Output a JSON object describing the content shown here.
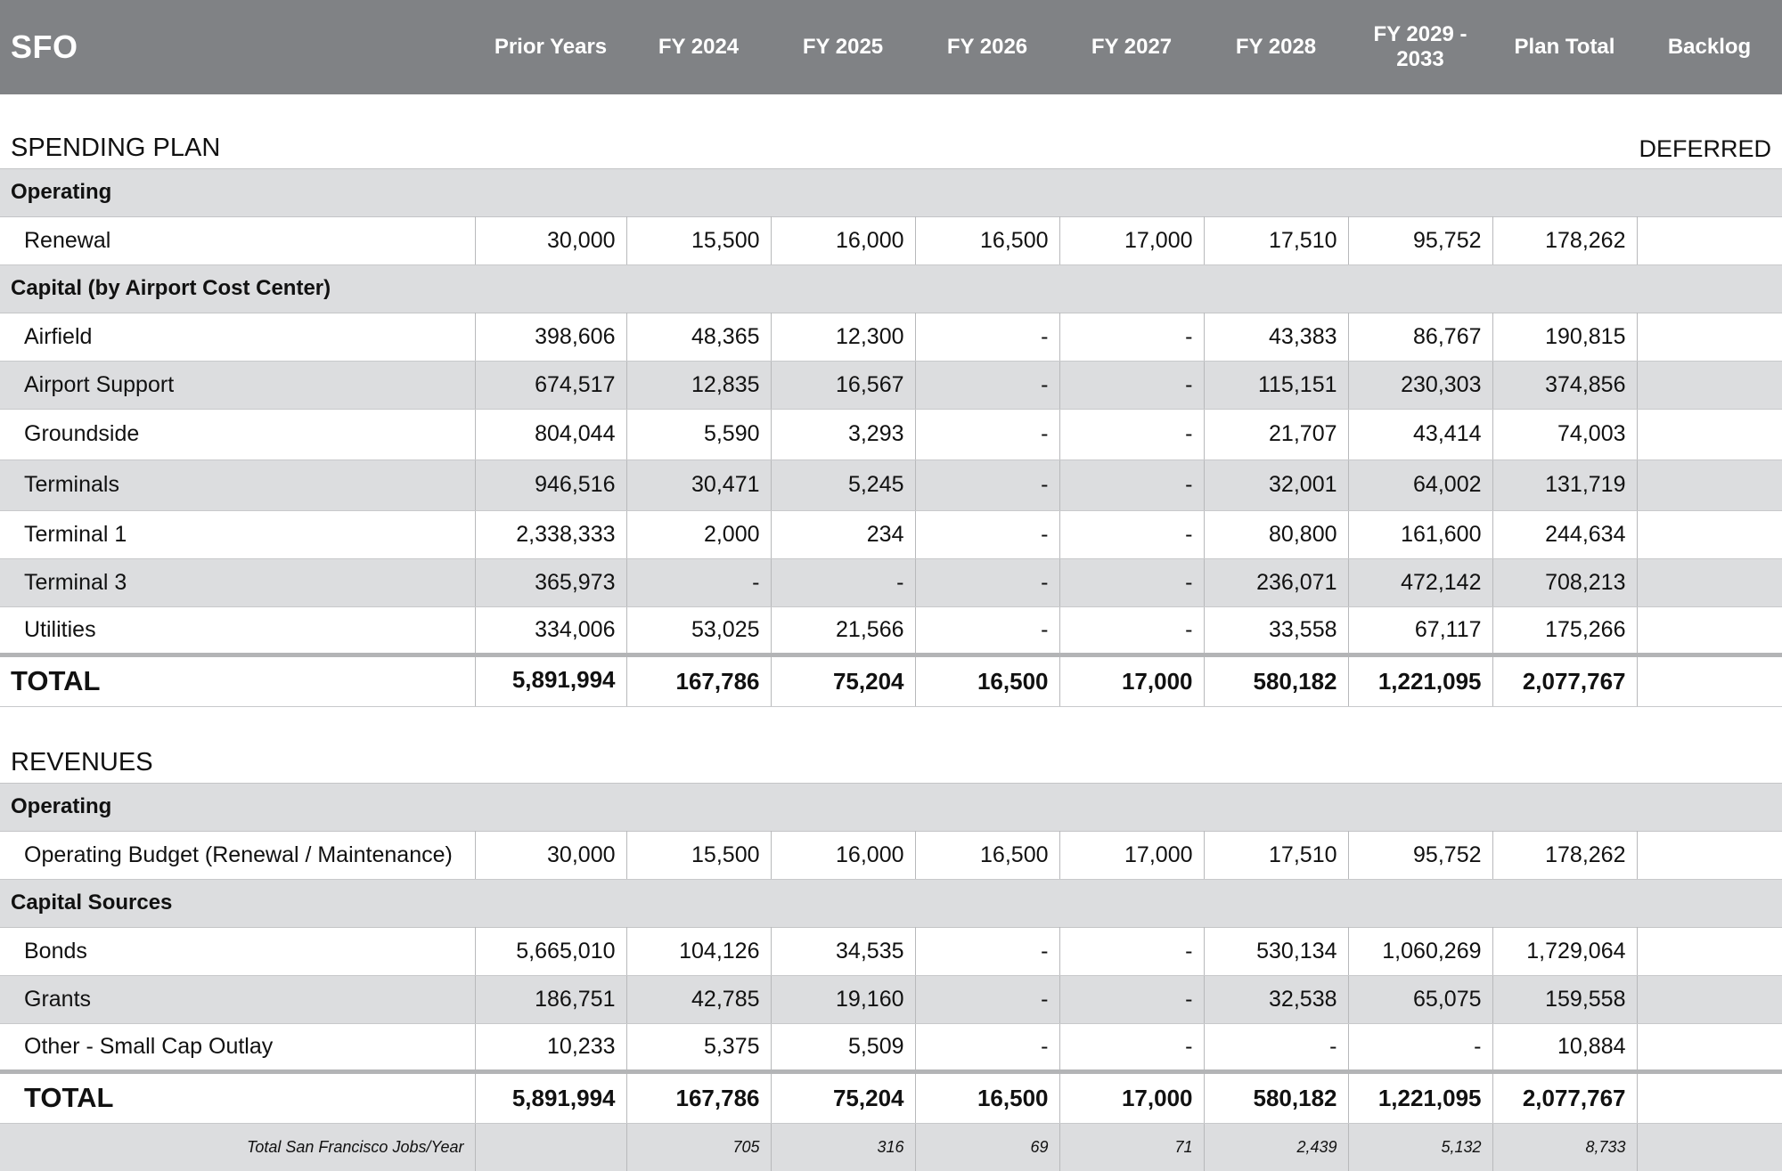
{
  "header": {
    "app": "SFO",
    "columns": [
      "Prior Years",
      "FY 2024",
      "FY 2025",
      "FY 2026",
      "FY 2027",
      "FY 2028",
      "FY 2029 - 2033",
      "Plan Total",
      "Backlog"
    ]
  },
  "spending": {
    "title": "SPENDING PLAN",
    "backlog_label": "DEFERRED",
    "operating": {
      "label": "Operating",
      "rows": [
        {
          "label": "Renewal",
          "values": [
            "30,000",
            "15,500",
            "16,000",
            "16,500",
            "17,000",
            "17,510",
            "95,752",
            "178,262",
            ""
          ]
        }
      ]
    },
    "capital": {
      "label": "Capital (by Airport Cost Center)",
      "rows": [
        {
          "label": "Airfield",
          "values": [
            "398,606",
            "48,365",
            "12,300",
            "-",
            "-",
            "43,383",
            "86,767",
            "190,815",
            ""
          ]
        },
        {
          "label": "Airport Support",
          "values": [
            "674,517",
            "12,835",
            "16,567",
            "-",
            "-",
            "115,151",
            "230,303",
            "374,856",
            ""
          ]
        },
        {
          "label": "Groundside",
          "values": [
            "804,044",
            "5,590",
            "3,293",
            "-",
            "-",
            "21,707",
            "43,414",
            "74,003",
            ""
          ]
        },
        {
          "label": "Terminals",
          "values": [
            "946,516",
            "30,471",
            "5,245",
            "-",
            "-",
            "32,001",
            "64,002",
            "131,719",
            ""
          ]
        },
        {
          "label": "Terminal 1",
          "values": [
            "2,338,333",
            "2,000",
            "234",
            "-",
            "-",
            "80,800",
            "161,600",
            "244,634",
            ""
          ]
        },
        {
          "label": "Terminal 3",
          "values": [
            "365,973",
            "-",
            "-",
            "-",
            "-",
            "236,071",
            "472,142",
            "708,213",
            ""
          ]
        },
        {
          "label": "Utilities",
          "values": [
            "334,006",
            "53,025",
            "21,566",
            "-",
            "-",
            "33,558",
            "67,117",
            "175,266",
            ""
          ]
        }
      ]
    },
    "total": {
      "label": "TOTAL",
      "values": [
        "5,891,994",
        "167,786",
        "75,204",
        "16,500",
        "17,000",
        "580,182",
        "1,221,095",
        "2,077,767",
        ""
      ]
    }
  },
  "revenues": {
    "title": "REVENUES",
    "operating": {
      "label": "Operating",
      "rows": [
        {
          "label": "Operating Budget (Renewal / Maintenance)",
          "values": [
            "30,000",
            "15,500",
            "16,000",
            "16,500",
            "17,000",
            "17,510",
            "95,752",
            "178,262",
            ""
          ]
        }
      ]
    },
    "capital": {
      "label": "Capital Sources",
      "rows": [
        {
          "label": "Bonds",
          "values": [
            "5,665,010",
            "104,126",
            "34,535",
            "-",
            "-",
            "530,134",
            "1,060,269",
            "1,729,064",
            ""
          ]
        },
        {
          "label": "Grants",
          "values": [
            "186,751",
            "42,785",
            "19,160",
            "-",
            "-",
            "32,538",
            "65,075",
            "159,558",
            ""
          ]
        },
        {
          "label": "Other - Small Cap Outlay",
          "values": [
            "10,233",
            "5,375",
            "5,509",
            "-",
            "-",
            "-",
            "-",
            "10,884",
            ""
          ]
        }
      ]
    },
    "total": {
      "label": "TOTAL",
      "values": [
        "5,891,994",
        "167,786",
        "75,204",
        "16,500",
        "17,000",
        "580,182",
        "1,221,095",
        "2,077,767",
        ""
      ]
    },
    "jobs": {
      "label": "Total San Francisco Jobs/Year",
      "values": [
        "",
        "705",
        "316",
        "69",
        "71",
        "2,439",
        "5,132",
        "8,733",
        ""
      ]
    }
  }
}
